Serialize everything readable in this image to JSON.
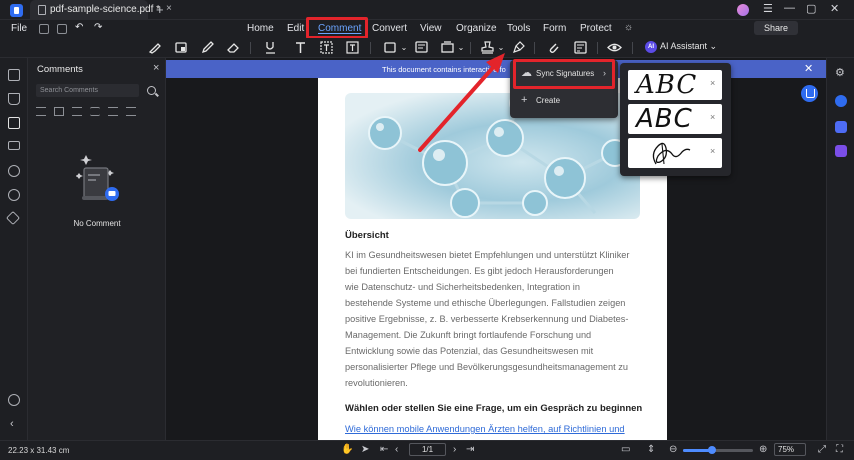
{
  "window": {
    "tab_title": "pdf-sample-science.pdf *",
    "tab_close": "×",
    "new_tab": "+",
    "min": "—",
    "max": "▢",
    "close": "✕"
  },
  "menubar": {
    "file": "File",
    "items": [
      "Home",
      "Edit",
      "Comment",
      "Convert",
      "View",
      "Organize",
      "Tools",
      "Form",
      "Protect"
    ],
    "active": "Comment",
    "share": "Share"
  },
  "toolbar": {
    "ai_badge": "AI",
    "ai_assistant": "AI Assistant ⌄"
  },
  "comments_panel": {
    "title": "Comments",
    "close": "×",
    "search_placeholder": "Search Comments",
    "empty_text": "No Comment"
  },
  "banner": {
    "text": "This document contains interactive fo",
    "close": "✕"
  },
  "document": {
    "heading": "Übersicht",
    "paragraph_lines": [
      "KI im Gesundheitswesen bietet Empfehlungen und unterstützt Kliniker",
      "bei fundierten Entscheidungen.  Es gibt jedoch Herausforderungen",
      "wie Datenschutz- und Sicherheitsbedenken, Integration in",
      "bestehende Systeme und ethische Überlegungen. Fallstudien zeigen",
      "positive Ergebnisse, z. B.  verbesserte Krebserkennung und Diabetes-",
      "Management. Die Zukunft bringt fortlaufende Forschung  und",
      "Entwicklung sowie das Potenzial, das Gesundheitswesen mit",
      "personalisierter Pflege und Bevölkerungsgesundheitsmanagement zu",
      "revolutionieren."
    ],
    "heading2": "Wählen oder stellen Sie eine Frage, um ein Gespräch zu beginnen",
    "link": "Wie können mobile Anwendungen Ärzten helfen, auf Richtlinien und"
  },
  "signature_menu": {
    "sync_label": "Sync Signatures",
    "create_label": "Create",
    "arrow": "›",
    "plus": "+"
  },
  "signatures": [
    {
      "text": "ABC",
      "remove": "×"
    },
    {
      "text": "ABC",
      "remove": "×"
    },
    {
      "text": "",
      "remove": "×"
    }
  ],
  "statusbar": {
    "dimensions": "22.23 x 31.43 cm",
    "page_indicator": "1/1",
    "zoom": "75%",
    "zoom_level": 0.42
  },
  "colors": {
    "accent": "#2f6cf0",
    "highlight": "#e3242b",
    "banner": "#4a63c7"
  }
}
